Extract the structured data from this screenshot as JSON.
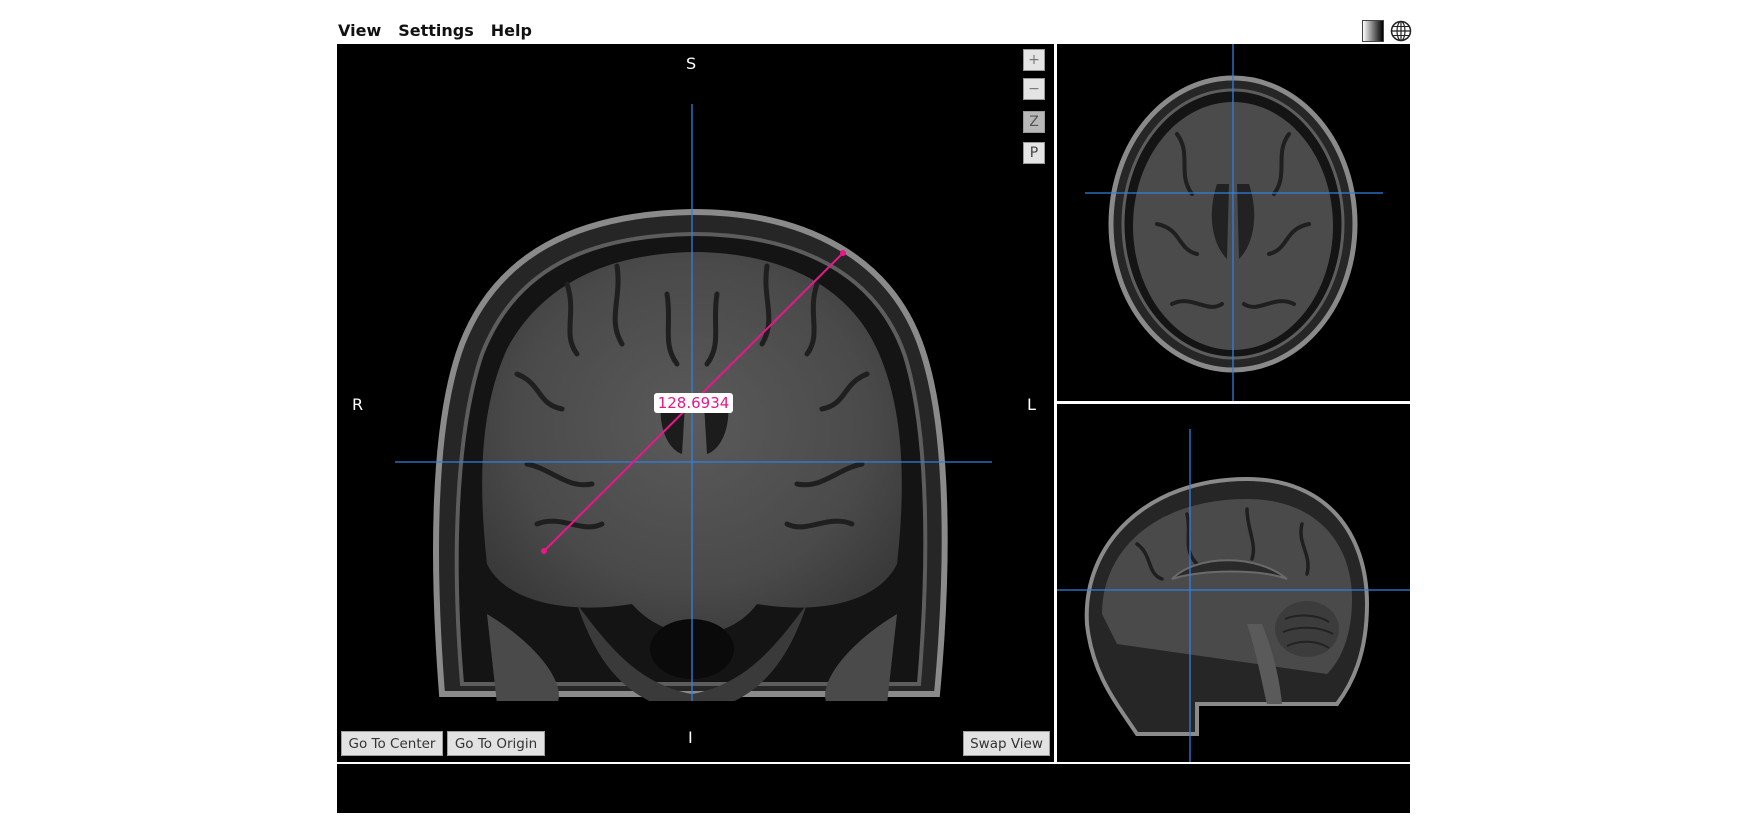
{
  "menu": {
    "view": "View",
    "settings": "Settings",
    "help": "Help"
  },
  "toolbar": {
    "contrast_icon": "contrast-icon",
    "globe_icon": "globe-icon"
  },
  "main_view": {
    "orientation": {
      "superior": "S",
      "inferior": "I",
      "right": "R",
      "left": "L"
    },
    "zoom_controls": {
      "zoom_in": "+",
      "zoom_out": "−",
      "z": "Z",
      "p": "P"
    },
    "measurement": {
      "value": "128.6934",
      "color": "#e8178a"
    },
    "crosshair_color": "#2f7fe0",
    "buttons": {
      "go_to_center": "Go To Center",
      "go_to_origin": "Go To Origin",
      "swap_view": "Swap View"
    }
  },
  "side_views": {
    "top": "axial",
    "bottom": "sagittal"
  }
}
